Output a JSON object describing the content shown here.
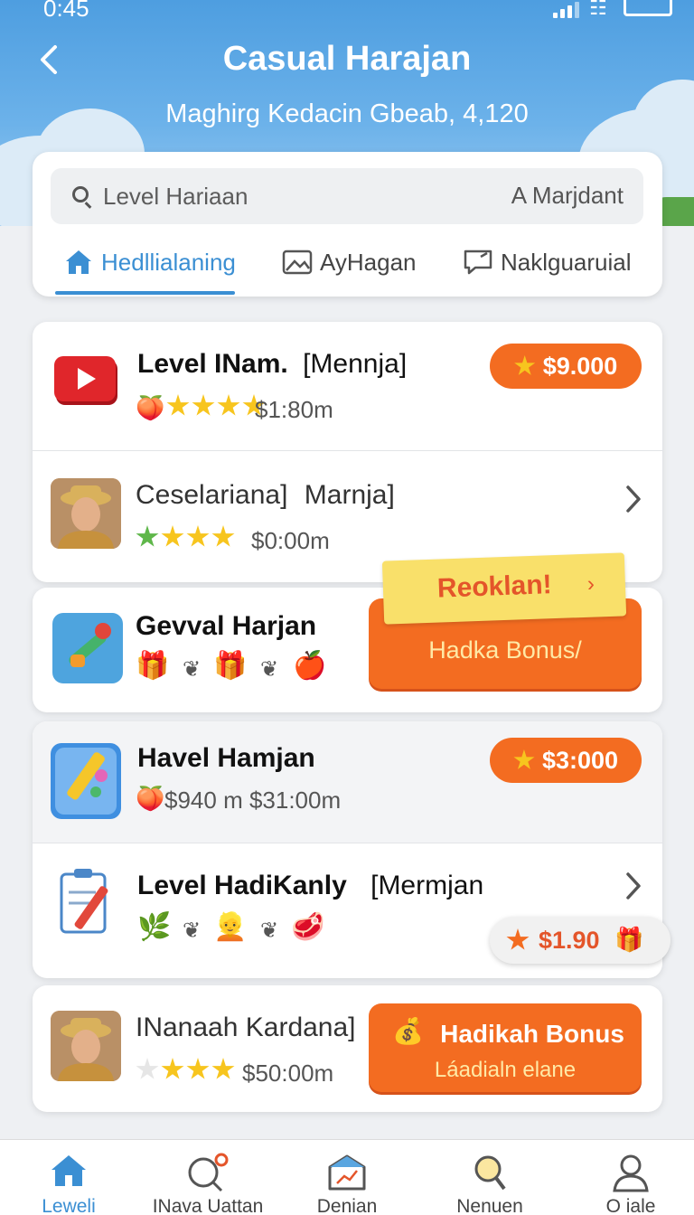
{
  "status_bar": {
    "time": "0:45"
  },
  "header": {
    "title": "Casual Harajan",
    "subtitle": "Maghirg Kedacin Gbeab, 4,120"
  },
  "search": {
    "placeholder": "Level Hariaan",
    "right_label": "A Marjdant"
  },
  "tabs": [
    {
      "label": "Hedllialaning",
      "icon": "home-icon",
      "active": true
    },
    {
      "label": "AyHagan",
      "icon": "image-icon",
      "active": false
    },
    {
      "label": "Naklguaruial",
      "icon": "message-icon",
      "active": false
    }
  ],
  "rows": {
    "r1": {
      "title": "Level INam.",
      "tag": "[Mennja]",
      "meta": "$1:80m",
      "badge": "$9.000",
      "icon": "video-play-icon"
    },
    "r2": {
      "title": "Ceselariana]",
      "tag": "Marnja]",
      "meta": "$0:00m",
      "icon": "avatar"
    },
    "r3": {
      "title": "Gevval Harjan",
      "ribbon": "Reoklan!",
      "bonus": "Hadka Bonus/",
      "icon": "tools-icon"
    },
    "r4": {
      "title": "Havel Hamjan",
      "meta": "$940 m  $31:00m",
      "badge": "$3:000",
      "icon": "pencil-app-icon"
    },
    "r5": {
      "title": "Level HadiKanly",
      "tag": "[Mermjan",
      "pill": "$1.90",
      "icon": "clipboard-pencil-icon"
    },
    "r6": {
      "title": "INanaah Kardana]",
      "meta": "$50:00m",
      "bonus": "Hadikah Bonus",
      "bonus_sub": "Láadialn elane",
      "icon": "avatar"
    }
  },
  "bottom_nav": [
    {
      "label": "Leweli",
      "icon": "home-icon",
      "active": true
    },
    {
      "label": "INava Uattan",
      "icon": "search-notification-icon",
      "active": false
    },
    {
      "label": "Denian",
      "icon": "house-chart-icon",
      "active": false
    },
    {
      "label": "Nenuen",
      "icon": "magnifier-icon",
      "active": false
    },
    {
      "label": "O iale",
      "icon": "profile-icon",
      "active": false
    }
  ],
  "colors": {
    "header_blue": "#4e9ee0",
    "accent_orange": "#f36c21",
    "tab_active_blue": "#3b8fd3",
    "star_yellow": "#f7c51e",
    "ribbon_yellow": "#f9e06a"
  }
}
